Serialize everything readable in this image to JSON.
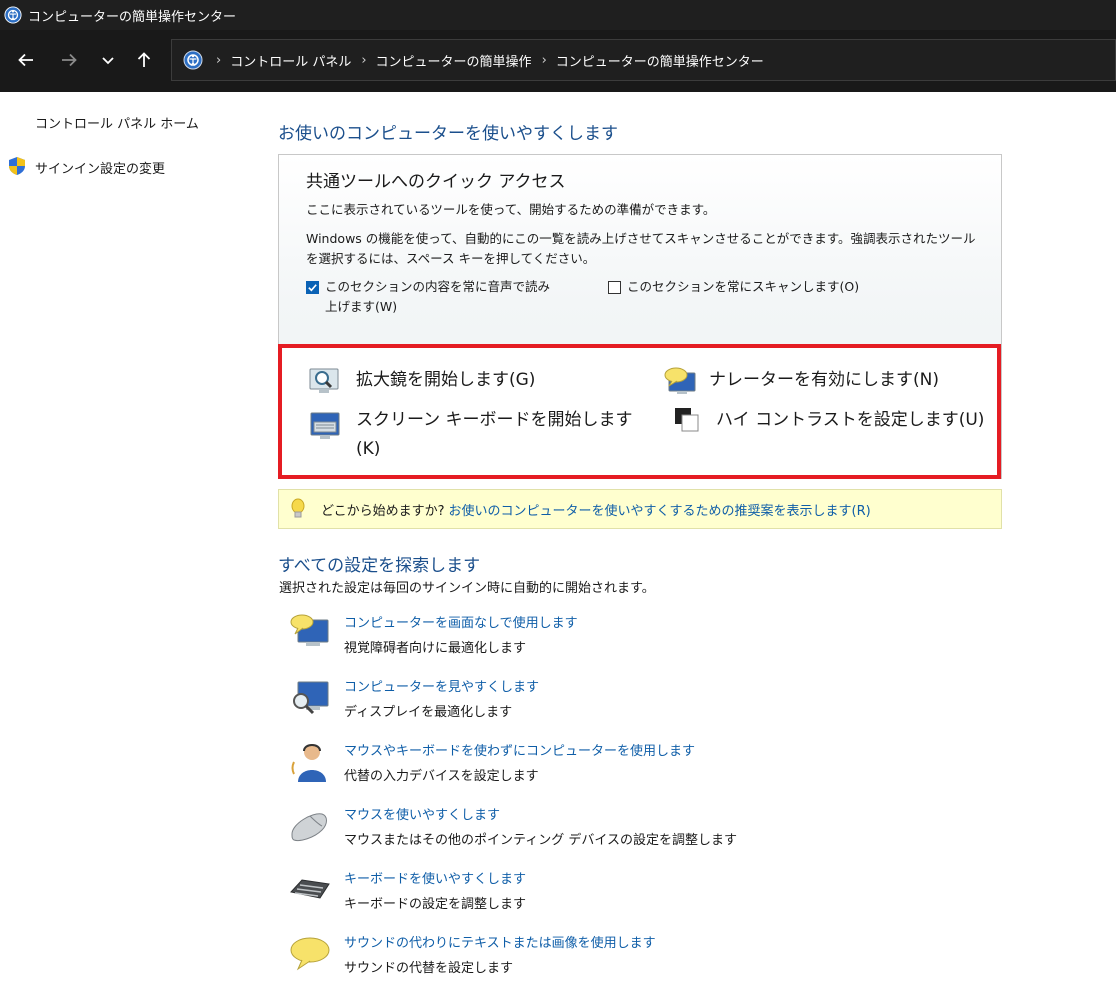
{
  "window": {
    "title": "コンピューターの簡単操作センター"
  },
  "nav": {
    "breadcrumbs": [
      "コントロール パネル",
      "コンピューターの簡単操作",
      "コンピューターの簡単操作センター"
    ],
    "separator": "›"
  },
  "sidebar": {
    "items": [
      {
        "label": "コントロール パネル ホーム",
        "icon": "none"
      },
      {
        "label": "サインイン設定の変更",
        "icon": "shield-icon"
      }
    ]
  },
  "main": {
    "heading": "お使いのコンピューターを使いやすくします",
    "quick_access": {
      "title": "共通ツールへのクイック アクセス",
      "line1": "ここに表示されているツールを使って、開始するための準備ができます。",
      "line2a": "Windows の機能を使って、自動的にこの一覧を読み上げさせてスキャンさせることができます。強調表示されたツール",
      "line2b": "を選択するには、スペース キーを押してください。",
      "checkbox_read": {
        "label_line1": "このセクションの内容を常に音声で読み",
        "label_line2": "上げます(W)",
        "checked": true
      },
      "checkbox_scan": {
        "label": "このセクションを常にスキャンします(O)",
        "checked": false
      },
      "tools": [
        {
          "label": "拡大鏡を開始します(G)",
          "icon": "magnifier-icon"
        },
        {
          "label": "ナレーターを有効にします(N)",
          "icon": "narrator-icon"
        },
        {
          "label_line1": "スクリーン キーボードを開始します",
          "label_line2": "(K)",
          "icon": "on-screen-keyboard-icon"
        },
        {
          "label": "ハイ コントラストを設定します(U)",
          "icon": "high-contrast-icon"
        }
      ]
    },
    "tip": {
      "question": "どこから始めますか?",
      "link": "お使いのコンピューターを使いやすくするための推奨案を表示します(R)"
    },
    "explore": {
      "heading": "すべての設定を探索します",
      "subtitle": "選択された設定は毎回のサインイン時に自動的に開始されます。",
      "items": [
        {
          "link": "コンピューターを画面なしで使用します",
          "desc": "視覚障碍者向けに最適化します",
          "icon": "monitor-speech-icon"
        },
        {
          "link": "コンピューターを見やすくします",
          "desc": "ディスプレイを最適化します",
          "icon": "monitor-magnifier-icon"
        },
        {
          "link": "マウスやキーボードを使わずにコンピューターを使用します",
          "desc": "代替の入力デバイスを設定します",
          "icon": "headset-user-icon"
        },
        {
          "link": "マウスを使いやすくします",
          "desc": "マウスまたはその他のポインティング デバイスの設定を調整します",
          "icon": "mouse-icon"
        },
        {
          "link": "キーボードを使いやすくします",
          "desc": "キーボードの設定を調整します",
          "icon": "keyboard-icon"
        },
        {
          "link": "サウンドの代わりにテキストまたは画像を使用します",
          "desc": "サウンドの代替を設定します",
          "icon": "speech-bubble-icon"
        }
      ]
    }
  },
  "colors": {
    "link": "#0f5ea8",
    "heading": "#1b4f8c",
    "highlight_frame": "#e51c23",
    "tip_background": "#ffffcf",
    "checkbox_checked": "#0a62b5"
  }
}
